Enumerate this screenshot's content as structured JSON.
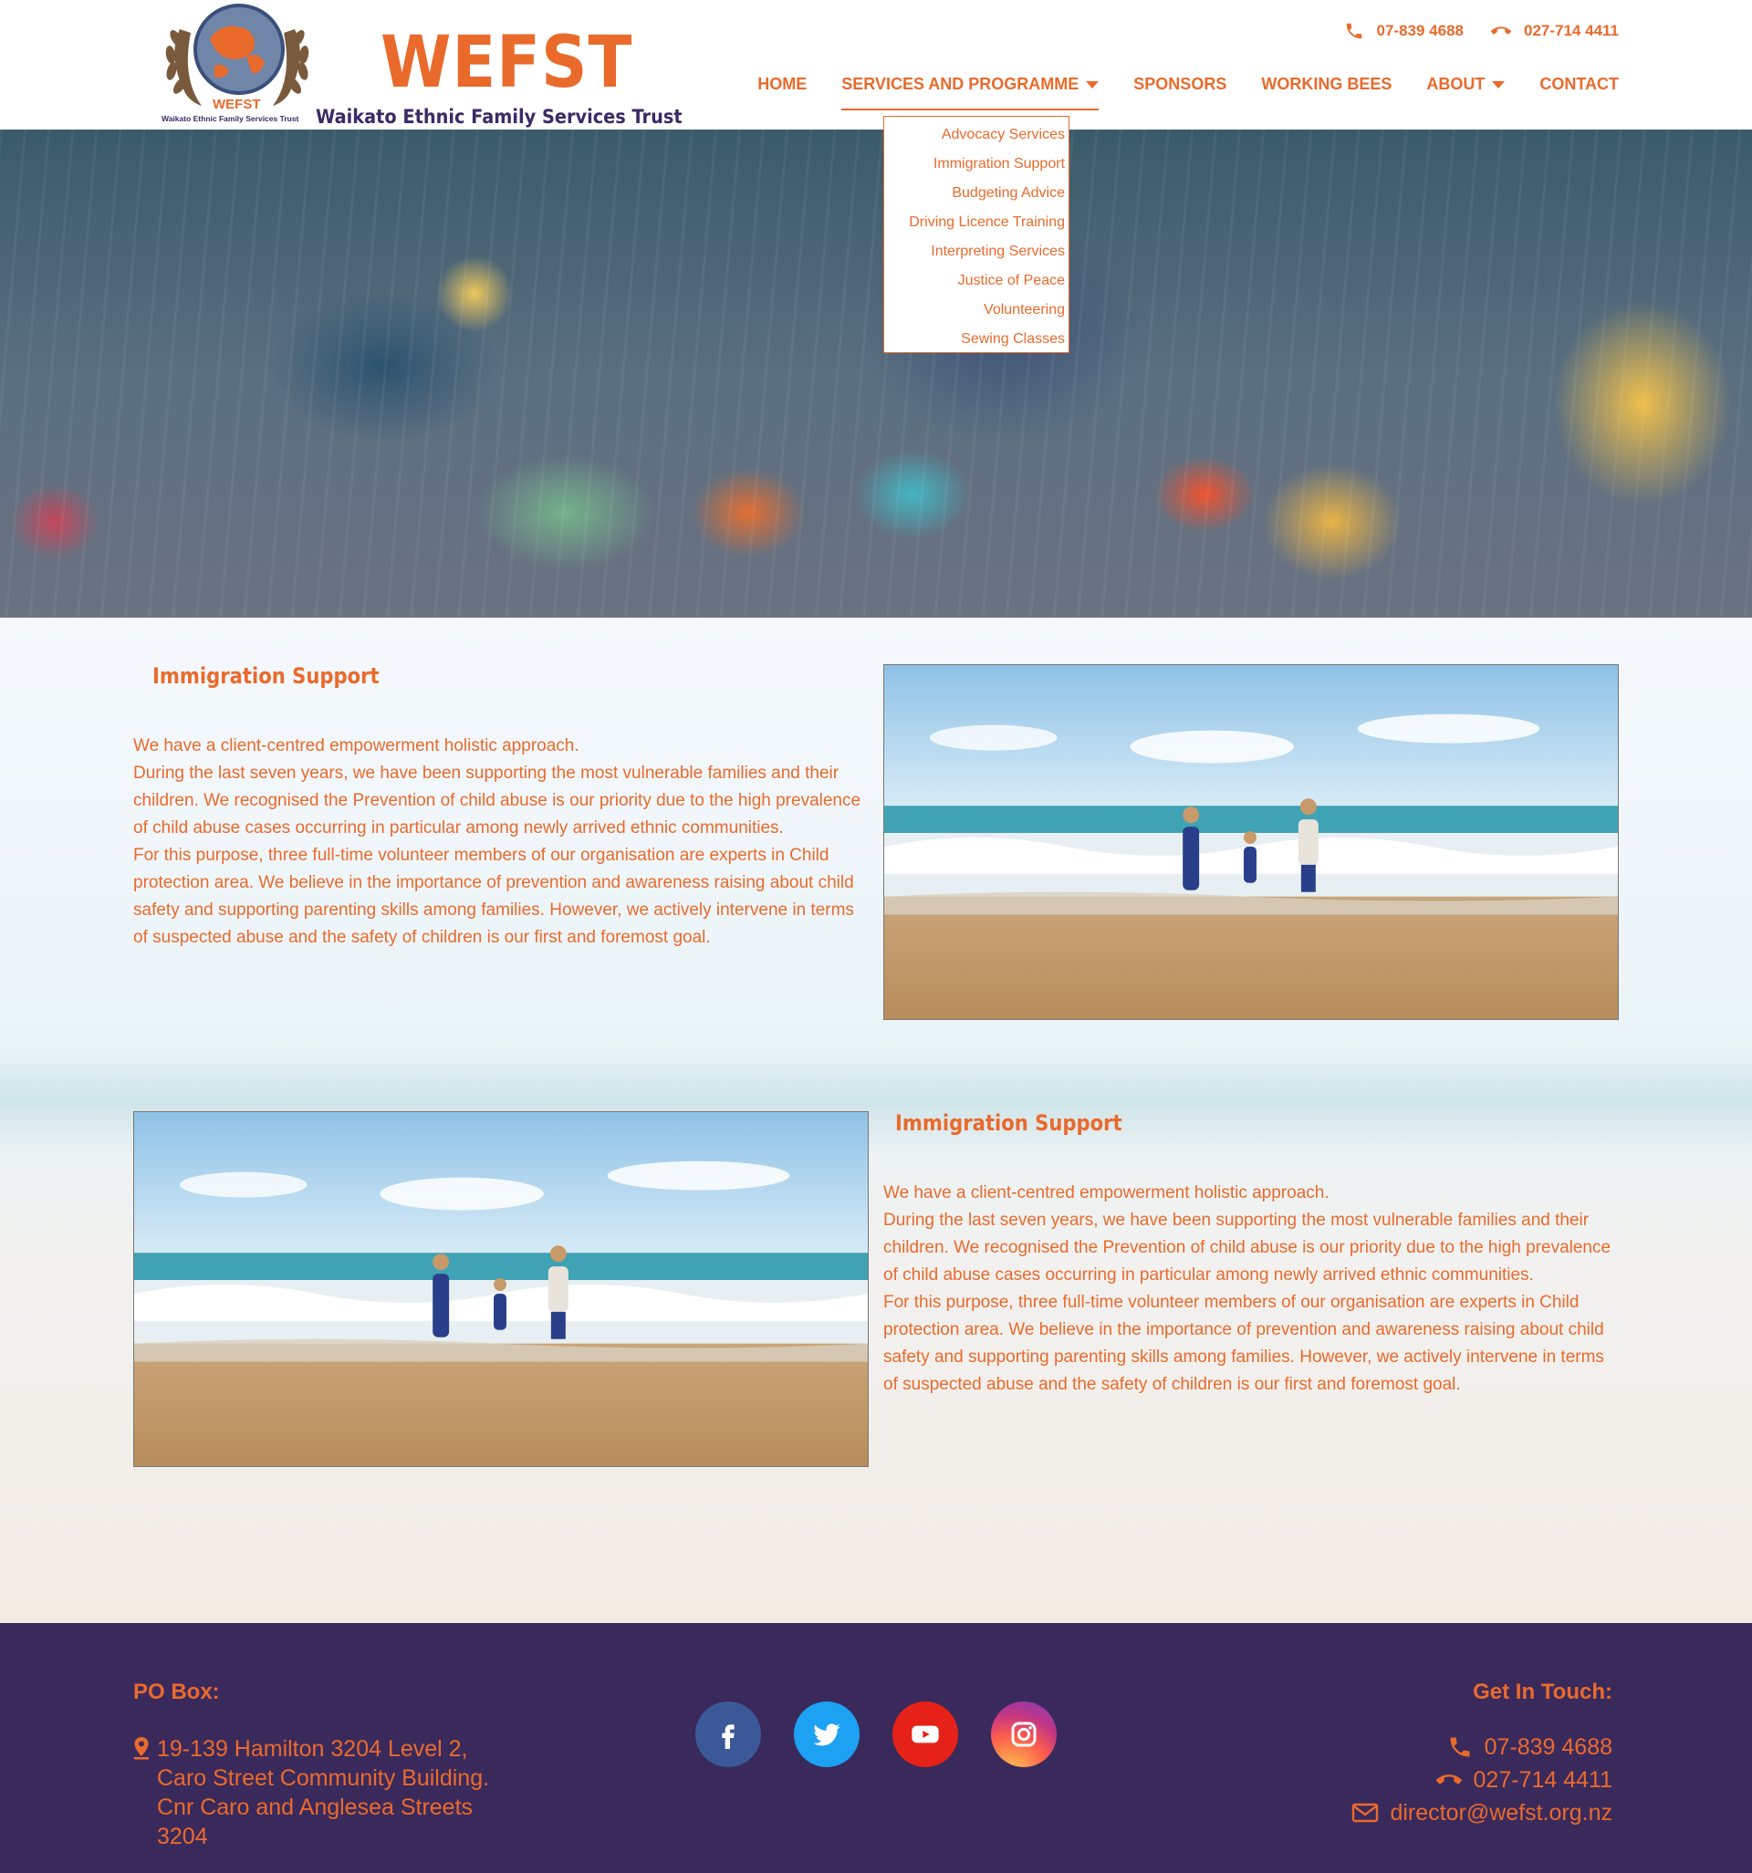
{
  "brand": {
    "emblem_text": "WEFST",
    "emblem_caption": "Waikato Ethnic Family Services Trust",
    "wordmark": "WEFST",
    "tagline": "Waikato Ethnic Family Services Trust"
  },
  "top_contacts": {
    "phone": "07-839 4688",
    "mobile": "027-714 4411"
  },
  "nav": {
    "items": [
      {
        "label": "HOME"
      },
      {
        "label": "SERVICES AND PROGRAMME"
      },
      {
        "label": "SPONSORS"
      },
      {
        "label": "WORKING BEES"
      },
      {
        "label": "ABOUT"
      },
      {
        "label": "CONTACT"
      }
    ]
  },
  "dropdown": {
    "items": [
      {
        "label": "Advocacy Services"
      },
      {
        "label": "Immigration Support"
      },
      {
        "label": "Budgeting Advice"
      },
      {
        "label": "Driving Licence Training"
      },
      {
        "label": "Interpreting Services"
      },
      {
        "label": "Justice of Peace"
      },
      {
        "label": "Volunteering"
      },
      {
        "label": "Sewing Classes"
      }
    ]
  },
  "sections": [
    {
      "title": "Immigration Support",
      "paragraphs": [
        "We have a client-centred empowerment holistic approach.",
        "During the last seven years, we have been supporting the most vulnerable families and their children. We recognised the Prevention of child abuse is our priority due to the high prevalence of child abuse cases occurring in particular among newly arrived ethnic communities.",
        "For this purpose, three full-time volunteer members of our organisation are experts in Child protection area. We believe in the importance of prevention and awareness raising about child safety and supporting parenting skills among families. However, we actively intervene in terms of suspected abuse and the safety of children is our first and foremost goal."
      ]
    },
    {
      "title": "Immigration Support",
      "paragraphs": [
        "We have a client-centred empowerment holistic approach.",
        "During the last seven years, we have been supporting the most vulnerable families and their children. We recognised the Prevention of child abuse is our priority due to the high prevalence of child abuse cases occurring in particular among newly arrived ethnic communities.",
        "For this purpose, three full-time volunteer members of our organisation are experts in Child protection area. We believe in the importance of prevention and awareness raising about child safety and supporting parenting skills among families. However, we actively intervene in terms of suspected abuse and the safety of children is our first and foremost goal."
      ]
    }
  ],
  "footer": {
    "po_box_heading": "PO Box:",
    "address": "19-139 Hamilton 3204 Level 2, Caro Street Community Building. Cnr Caro and Anglesea Streets 3204",
    "socials": [
      "facebook-icon",
      "twitter-icon",
      "youtube-icon",
      "instagram-icon"
    ],
    "touch_heading": "Get In Touch:",
    "phone": "07-839 4688",
    "mobile": "027-714 4411",
    "email": "director@wefst.org.nz"
  },
  "colors": {
    "accent": "#ea6a2c",
    "footer_bg": "#3a2a5c",
    "brand_navy": "#3c2a66"
  }
}
